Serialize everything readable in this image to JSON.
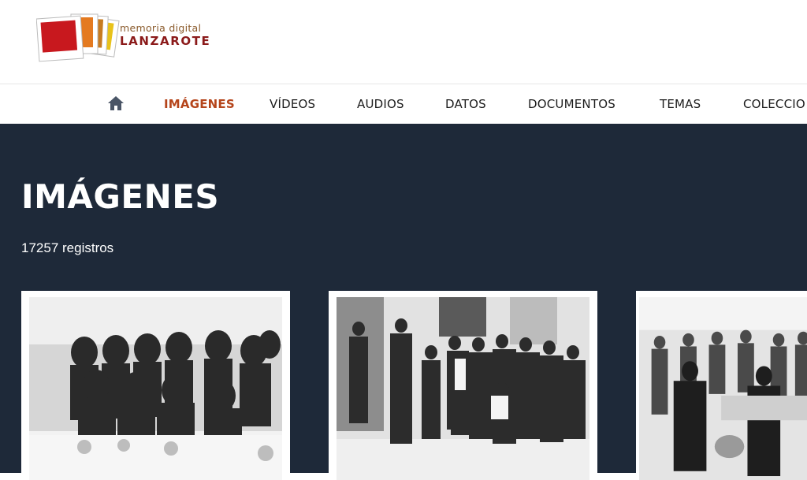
{
  "logo": {
    "small": "memoria digital",
    "big": "LANZAROTE"
  },
  "nav": {
    "home_icon": "home-icon",
    "items": [
      {
        "label": "IMÁGENES",
        "active": true
      },
      {
        "label": "VÍDEOS"
      },
      {
        "label": "AUDIOS"
      },
      {
        "label": "DATOS"
      },
      {
        "label": "DOCUMENTOS"
      },
      {
        "label": "TEMAS"
      },
      {
        "label": "COLECCIO"
      }
    ]
  },
  "main": {
    "title": "IMÁGENES",
    "count": "17257 registros"
  },
  "colors": {
    "band": "#1e2939",
    "accent": "#b5451b",
    "logo_red": "#8b1a1a"
  }
}
